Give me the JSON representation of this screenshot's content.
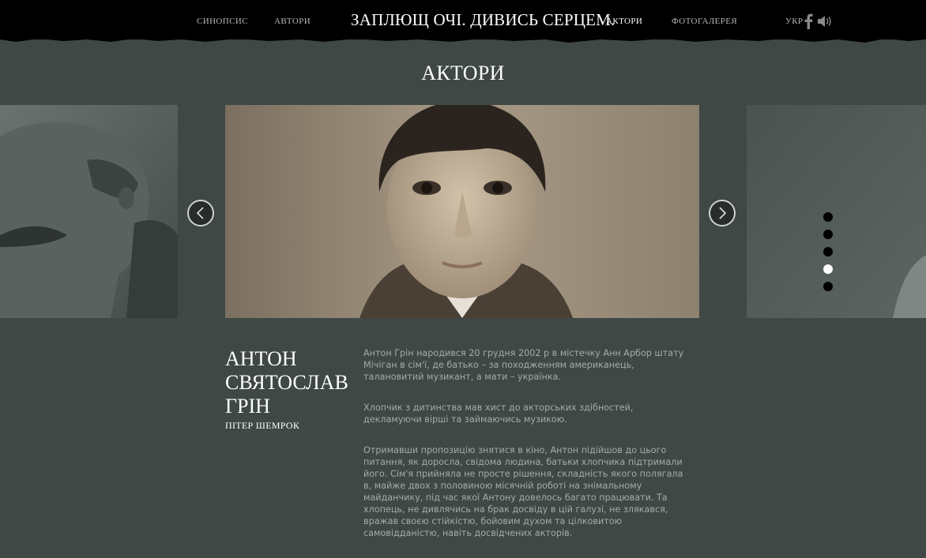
{
  "nav": {
    "synopsis": "СИНОПСИС",
    "authors": "АВТОРИ",
    "title": "ЗАПЛЮЩ ОЧІ. ДИВИСЬ СЕРЦЕМ.",
    "actors": "АКТОРИ",
    "gallery": "ФОТОГАЛЕРЕЯ",
    "language": "УКР"
  },
  "icons": {
    "facebook": "facebook-icon",
    "sound": "speaker-icon",
    "prev": "chevron-left-icon",
    "next": "chevron-right-icon"
  },
  "page": {
    "heading": "АКТОРИ"
  },
  "slider": {
    "slide_count": 5,
    "active_index": 3
  },
  "actor": {
    "name_line1": "АНТОН",
    "name_line2": "СВЯТОСЛАВ",
    "name_line3": "ГРІН",
    "role": "ПІТЕР ШЕМРОК",
    "bio": [
      "Антон Грін народився 20 грудня 2002 р в містечку Анн Арбор штату Мічіган в сім'ї, де батько – за походженням американець, талановитий музикант, а мати – українка.",
      "Хлопчик з дитинства мав хист до акторських здібностей, декламуючи вірші та займаючись музикою.",
      "Отримавши пропозицію знятися в кіно, Антон підійшов до цього питання, як доросла, свідома людина, батьки хлопчика підтримали його. Сім'я прийняла не просте рішення, складність якого полягала в, майже двох з половиною місячній роботі на знімальному майданчику, під час якої Антону довелось багато працювати. Та хлопець, не дивлячись на брак досвіду в цій галузі, не злякався, вражав своєю стійкістю, бойовим духом та цілковитою самовідданістю, навіть досвідчених акторів."
    ]
  },
  "colors": {
    "background": "#3f4845",
    "topbar": "#000000",
    "text_primary": "#ffffff",
    "text_muted": "#a6aaa8",
    "nav_inactive": "#b4b4b4"
  }
}
